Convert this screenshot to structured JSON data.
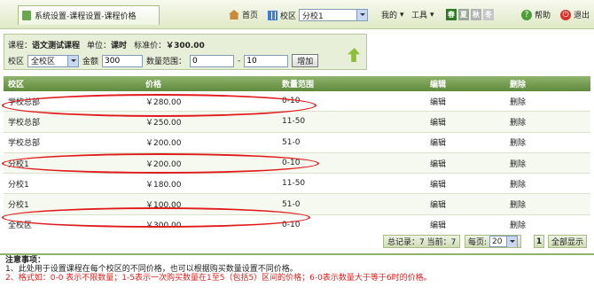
{
  "topbar": {
    "title": "系统设置-课程设置-课程价格",
    "home_label": "首页",
    "campus_label": "校区",
    "campus_value": "分校1",
    "mine_label": "我的",
    "tools_label": "工具",
    "themes": [
      "春",
      "夏",
      "秋",
      "冬"
    ],
    "help_label": "帮助",
    "exit_label": "退出"
  },
  "filter": {
    "course_label": "课程：",
    "course_value": "语文测试课程",
    "unit_label": "单位：",
    "unit_value": "课时",
    "std_price_label": "标准价：",
    "std_price_value": "￥300.00",
    "campus_label": "校区",
    "campus_value": "全校区",
    "amount_label": "金额",
    "amount_value": "300",
    "range_label": "数量范围：",
    "range_from": "0",
    "range_sep": "-",
    "range_to": "10",
    "add_button": "增加"
  },
  "table": {
    "headers": [
      "校区",
      "价格",
      "数量范围",
      "编辑",
      "删除"
    ],
    "rows": [
      [
        "学校总部",
        "￥280.00",
        "0-10",
        "编辑",
        "删除"
      ],
      [
        "学校总部",
        "￥250.00",
        "11-50",
        "编辑",
        "删除"
      ],
      [
        "学校总部",
        "￥200.00",
        "51-0",
        "编辑",
        "删除"
      ],
      [
        "分校1",
        "￥200.00",
        "0-10",
        "编辑",
        "删除"
      ],
      [
        "分校1",
        "￥180.00",
        "11-50",
        "编辑",
        "删除"
      ],
      [
        "分校1",
        "￥100.00",
        "51-0",
        "编辑",
        "删除"
      ],
      [
        "全校区",
        "￥300.00",
        "0-10",
        "编辑",
        "删除"
      ]
    ]
  },
  "pager": {
    "total_label": "总记录：7 当前：7",
    "per_page_label": "每页:",
    "per_page_value": "20",
    "page_number": "1",
    "show_all": "全部显示"
  },
  "notes": {
    "title": "注意事项：",
    "line1": "1、此处用于设置课程在每个校区的不同价格，也可以根据购买数量设置不同价格。",
    "line2": "2、格式如：0-0 表示不限数量；1-5表示一次购买数量在1至5（包括5）区间的价格；6-0表示数量大于等于6时的价格。"
  },
  "colors": {
    "header_green": "#5f8a3c",
    "annotation_red": "#e01b1b",
    "note_red": "#e0201d"
  }
}
